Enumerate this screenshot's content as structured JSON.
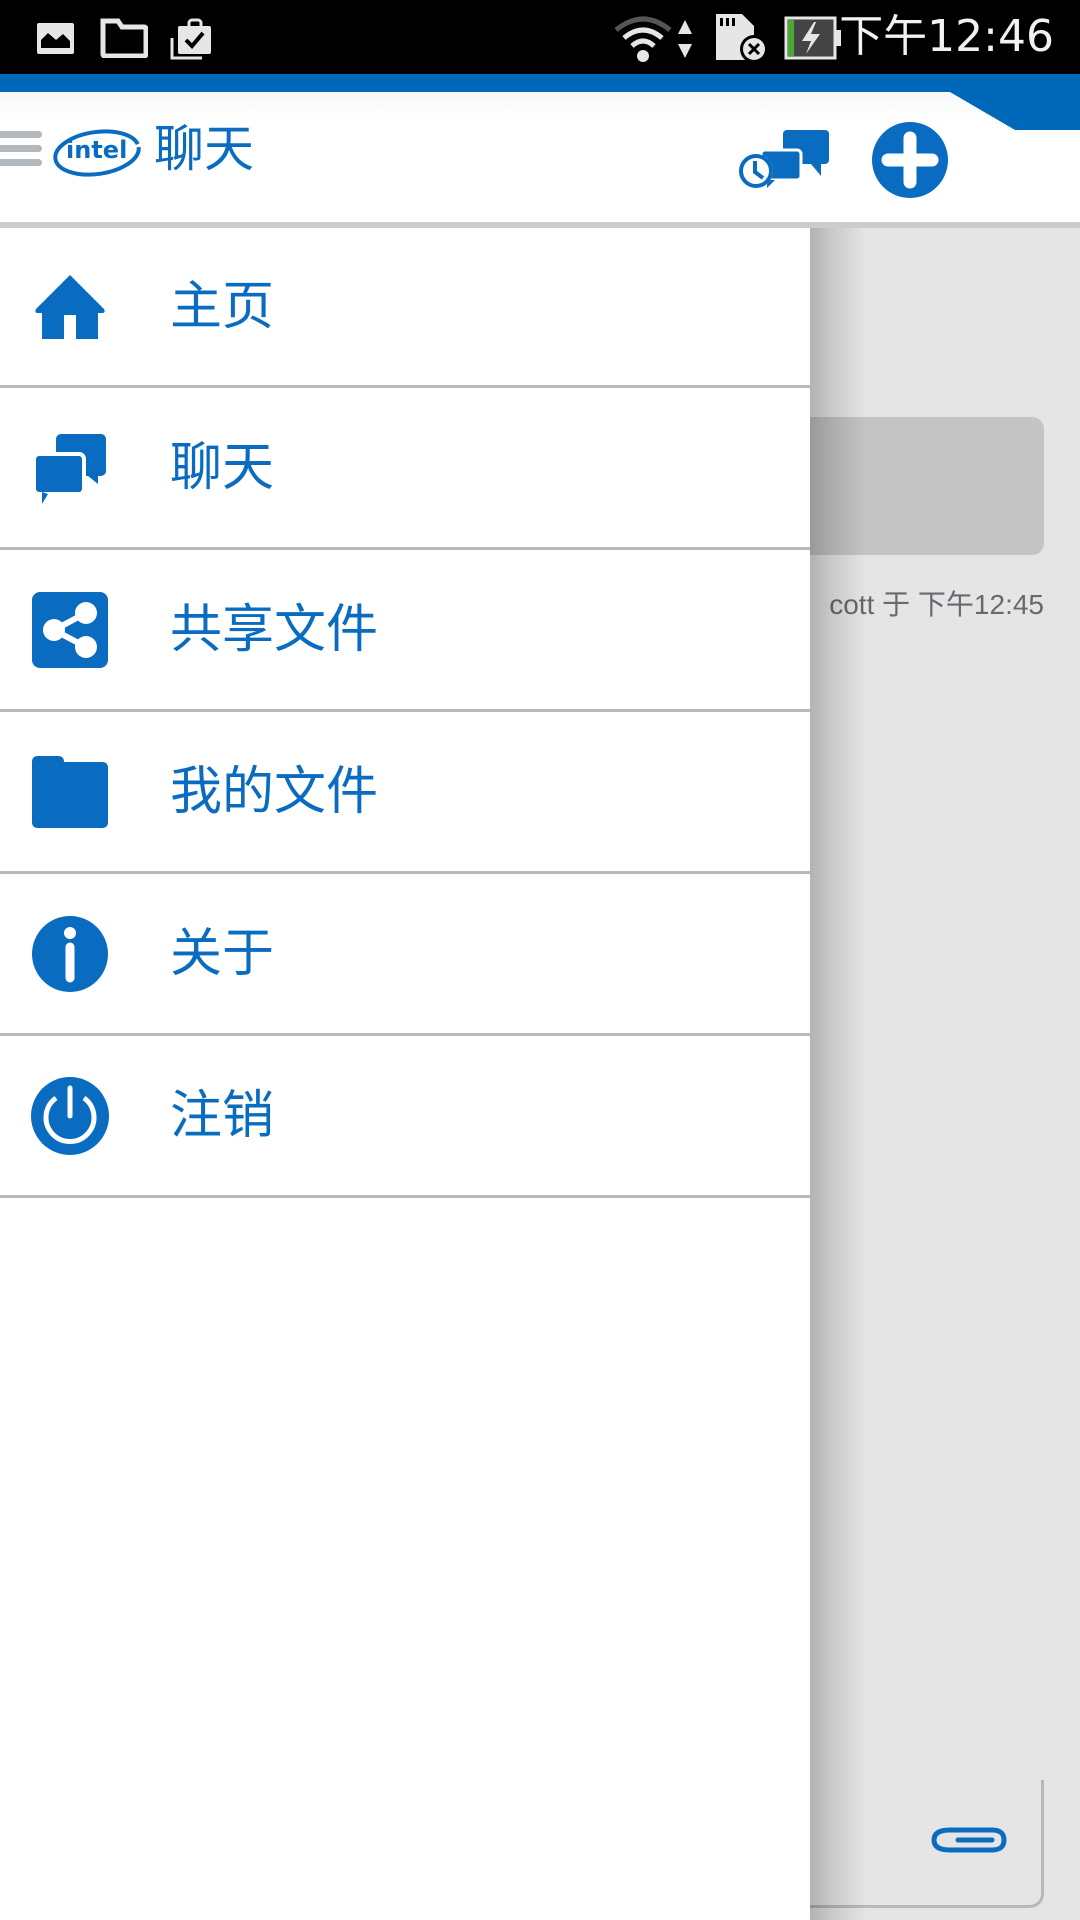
{
  "status_bar": {
    "time": "下午12:46",
    "left_icons": [
      "gallery-notification-icon",
      "folder-notification-icon",
      "clipboard-check-notification-icon"
    ],
    "right_icons": [
      "wifi-icon",
      "data-transfer-icon",
      "sd-card-error-icon",
      "battery-charging-icon"
    ]
  },
  "header": {
    "logo": "intel",
    "title": "聊天",
    "actions": [
      "chat-history-icon",
      "add-icon"
    ]
  },
  "drawer": {
    "items": [
      {
        "label": "主页",
        "icon": "home-icon"
      },
      {
        "label": "聊天",
        "icon": "chat-bubbles-icon"
      },
      {
        "label": "共享文件",
        "icon": "share-icon"
      },
      {
        "label": "我的文件",
        "icon": "folder-icon"
      },
      {
        "label": "关于",
        "icon": "info-icon"
      },
      {
        "label": "注销",
        "icon": "power-icon"
      }
    ]
  },
  "background": {
    "message_meta": "cott 于 下午12:45",
    "attach_icon": "paperclip-icon"
  },
  "colors": {
    "brand_blue": "#0a6cc0",
    "status_bar": "#000000",
    "divider": "#b3b9bd",
    "background": "#e5e5e5"
  }
}
